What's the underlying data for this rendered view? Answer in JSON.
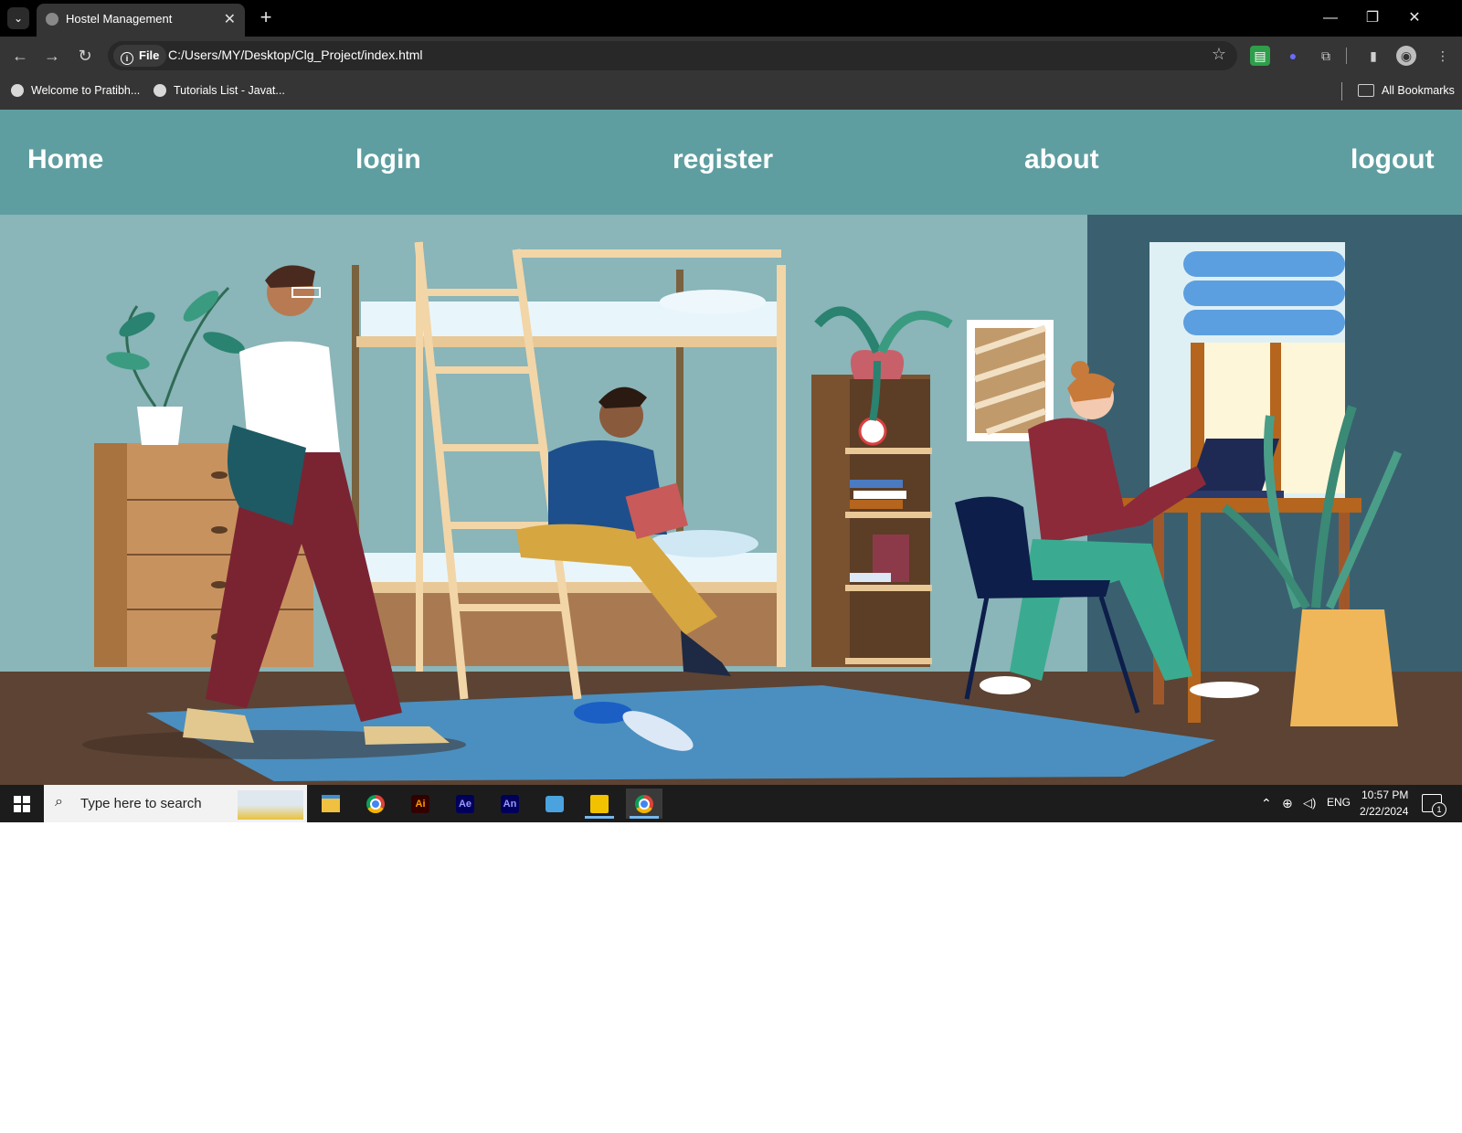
{
  "browser": {
    "tab": {
      "title": "Hostel Management",
      "close_glyph": "✕"
    },
    "new_tab_glyph": "+",
    "window_controls": {
      "minimize": "—",
      "restore": "❐",
      "close": "✕"
    },
    "address": {
      "scheme_label": "File",
      "url": "C:/Users/MY/Desktop/Clg_Project/index.html"
    },
    "bookmarks": [
      {
        "label": "Welcome to Pratibh..."
      },
      {
        "label": "Tutorials List - Javat..."
      }
    ],
    "all_bookmarks_label": "All Bookmarks"
  },
  "site": {
    "nav": [
      {
        "label": "Home"
      },
      {
        "label": "login"
      },
      {
        "label": "register"
      },
      {
        "label": "about"
      },
      {
        "label": "logout"
      }
    ],
    "colors": {
      "nav_bg": "#5f9ea0",
      "wall": "#8ab5b9",
      "floor": "#5c4333",
      "rug": "#4a8fc0"
    }
  },
  "taskbar": {
    "search_placeholder": "Type here to search",
    "apps": [
      {
        "name": "file-explorer-icon",
        "label": ""
      },
      {
        "name": "chrome-icon",
        "label": ""
      },
      {
        "name": "illustrator-icon",
        "label": "Ai"
      },
      {
        "name": "after-effects-icon",
        "label": "Ae"
      },
      {
        "name": "animate-icon",
        "label": "An"
      },
      {
        "name": "screen-recorder-icon",
        "label": ""
      },
      {
        "name": "yellow-app-icon",
        "label": ""
      },
      {
        "name": "chrome-active-icon",
        "label": ""
      }
    ],
    "language": "ENG",
    "time": "10:57 PM",
    "date": "2/22/2024",
    "notification_count": "1"
  }
}
